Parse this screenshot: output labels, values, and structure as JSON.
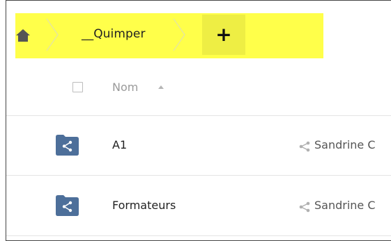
{
  "breadcrumb": {
    "home_icon": "home-icon",
    "current_folder": "__Quimper",
    "add_button_label": "+",
    "highlight_color": "#ffff4a"
  },
  "file_list": {
    "header": {
      "name_column": "Nom",
      "sort": "ascending"
    },
    "rows": [
      {
        "name": "A1",
        "icon": "shared-folder-icon",
        "shared_with": "Sandrine C"
      },
      {
        "name": "Formateurs",
        "icon": "shared-folder-icon",
        "shared_with": "Sandrine C"
      }
    ]
  },
  "colors": {
    "folder_icon": "#4d6f9a",
    "separator": "#e0e0e0",
    "muted_text": "#9a9a9a"
  }
}
